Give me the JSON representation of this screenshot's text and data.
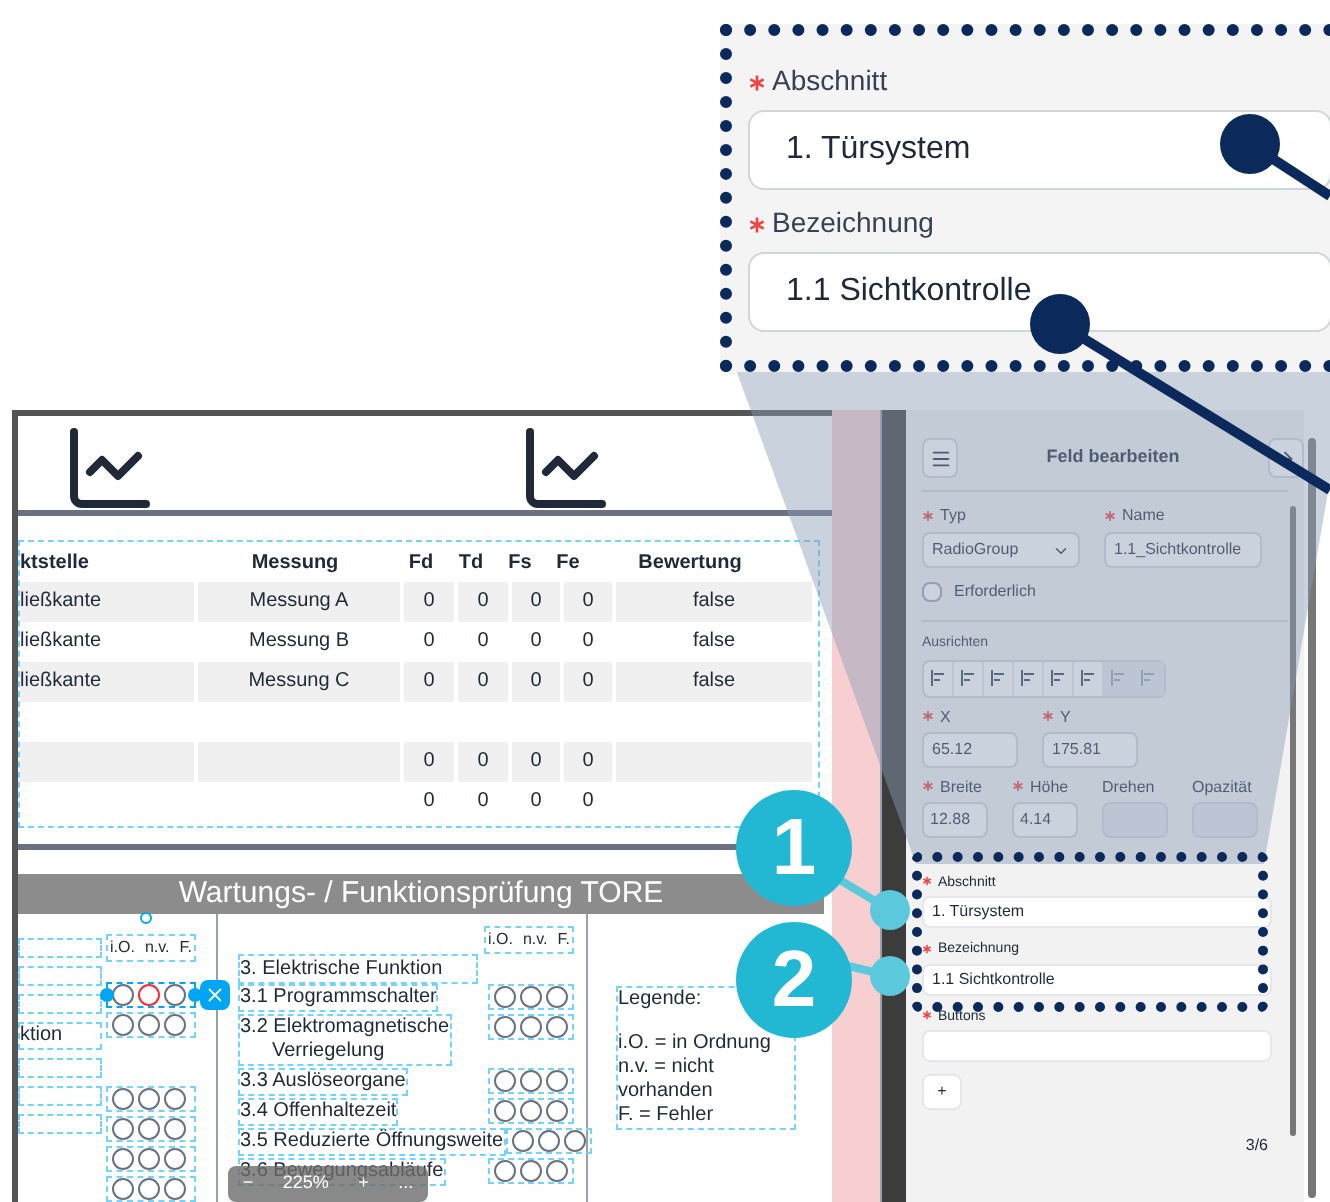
{
  "callout": {
    "fields": [
      {
        "label": "Abschnitt",
        "value": "1. Türsystem",
        "required": true
      },
      {
        "label": "Bezeichnung",
        "value": "1.1 Sichtkontrolle",
        "required": true
      }
    ]
  },
  "table": {
    "columns": [
      "ktstelle",
      "Messung",
      "Fd",
      "Td",
      "Fs",
      "Fe",
      "Bewertung"
    ],
    "rows": [
      {
        "kind": "data",
        "cells": [
          "ließkante",
          "Messung A",
          "0",
          "0",
          "0",
          "0",
          "false"
        ]
      },
      {
        "kind": "data",
        "cells": [
          "ließkante",
          "Messung B",
          "0",
          "0",
          "0",
          "0",
          "false"
        ]
      },
      {
        "kind": "data",
        "cells": [
          "ließkante",
          "Messung C",
          "0",
          "0",
          "0",
          "0",
          "false"
        ]
      },
      {
        "kind": "blank"
      },
      {
        "kind": "data",
        "cells": [
          "",
          "",
          "0",
          "0",
          "0",
          "0",
          ""
        ]
      },
      {
        "kind": "data",
        "cells": [
          "",
          "",
          "0",
          "0",
          "0",
          "0",
          ""
        ]
      }
    ]
  },
  "form": {
    "title": "Wartungs- / Funktionsprüfung TORE",
    "left_fields": [
      {
        "kind": "blank"
      },
      {
        "kind": "blank"
      },
      {
        "kind": "blank"
      },
      {
        "kind": "text",
        "text": "ktion"
      },
      {
        "kind": "blank"
      },
      {
        "kind": "blank"
      },
      {
        "kind": "blank"
      }
    ],
    "left_header": [
      "i.O.",
      "n.v.",
      "F."
    ],
    "left_radio_groups": [
      [
        {
          "selected": true,
          "radios": [
            {
              "selected": false
            },
            {
              "selected": false
            },
            {
              "selected": false
            }
          ]
        },
        {
          "selected": false,
          "radios": [
            {
              "selected": false
            },
            {
              "selected": false
            },
            {
              "selected": false
            }
          ]
        }
      ],
      [
        {
          "selected": false,
          "radios": [
            {
              "selected": false
            },
            {
              "selected": false
            },
            {
              "selected": false
            }
          ]
        },
        {
          "selected": false,
          "radios": [
            {
              "selected": false
            },
            {
              "selected": false
            },
            {
              "selected": false
            }
          ]
        },
        {
          "selected": false,
          "radios": [
            {
              "selected": false
            },
            {
              "selected": false
            },
            {
              "selected": false
            }
          ]
        },
        {
          "selected": false,
          "radios": [
            {
              "selected": false
            },
            {
              "selected": false
            },
            {
              "selected": false
            }
          ]
        }
      ]
    ],
    "section_title": "3. Elektrische Funktion",
    "mid_header": [
      "i.O.",
      "n.v.",
      "F."
    ],
    "items": [
      {
        "text": "3.1 Programmschalter",
        "radios": [
          {
            "selected": false
          },
          {
            "selected": false
          },
          {
            "selected": false
          }
        ]
      },
      {
        "text": "3.2 Elektromagnetische\nVerriegelung",
        "radios": [
          {
            "selected": false
          },
          {
            "selected": false
          },
          {
            "selected": false
          }
        ]
      },
      {
        "text": "3.3 Auslöseorgane",
        "radios": [
          {
            "selected": false
          },
          {
            "selected": false
          },
          {
            "selected": false
          }
        ]
      },
      {
        "text": "3.4 Offenhaltezeit",
        "radios": [
          {
            "selected": false
          },
          {
            "selected": false
          },
          {
            "selected": false
          }
        ]
      },
      {
        "text": "3.5 Reduzierte Öffnungsweite",
        "radios": [
          {
            "selected": false
          },
          {
            "selected": false
          },
          {
            "selected": false
          }
        ]
      },
      {
        "text": "3.6 Bewegungsabläufe",
        "radios": [
          {
            "selected": false
          },
          {
            "selected": false
          },
          {
            "selected": false
          }
        ]
      }
    ],
    "legend": [
      "Legende:",
      "i.O. = in Ordnung",
      "n.v. = nicht vorhanden",
      "F. = Fehler"
    ]
  },
  "zoom_bar": {
    "minus": "−",
    "level": "225%",
    "plus": "+",
    "more": "..."
  },
  "panel": {
    "title": "Feld bearbeiten",
    "typ": {
      "label": "Typ",
      "value": "RadioGroup",
      "required": true
    },
    "name": {
      "label": "Name",
      "value": "1.1_Sichtkontrolle",
      "required": true
    },
    "required": {
      "label": "Erforderlich",
      "checked": false
    },
    "align_label": "Ausrichten",
    "align_buttons": [
      {
        "disabled": false
      },
      {
        "disabled": false
      },
      {
        "disabled": false
      },
      {
        "disabled": false
      },
      {
        "disabled": false
      },
      {
        "disabled": false
      },
      {
        "disabled": true
      },
      {
        "disabled": true
      }
    ],
    "pos": [
      {
        "label": "X",
        "value": "65.12",
        "required": true
      },
      {
        "label": "Y",
        "value": "175.81",
        "required": true
      }
    ],
    "dims": [
      {
        "label": "Breite",
        "value": "12.88",
        "required": true,
        "disabled": false
      },
      {
        "label": "Höhe",
        "value": "4.14",
        "required": true,
        "disabled": false
      },
      {
        "label": "Drehen",
        "required": false,
        "disabled": true
      },
      {
        "label": "Opazität",
        "required": false,
        "disabled": true
      }
    ],
    "fields": [
      {
        "label": "Abschnitt",
        "value": "1. Türsystem",
        "required": true
      },
      {
        "label": "Bezeichnung",
        "value": "1.1 Sichtkontrolle",
        "required": true
      },
      {
        "label": "Buttons",
        "required": true
      }
    ],
    "add": "+",
    "pager": "3/6"
  },
  "badges": [
    "1",
    "2"
  ]
}
